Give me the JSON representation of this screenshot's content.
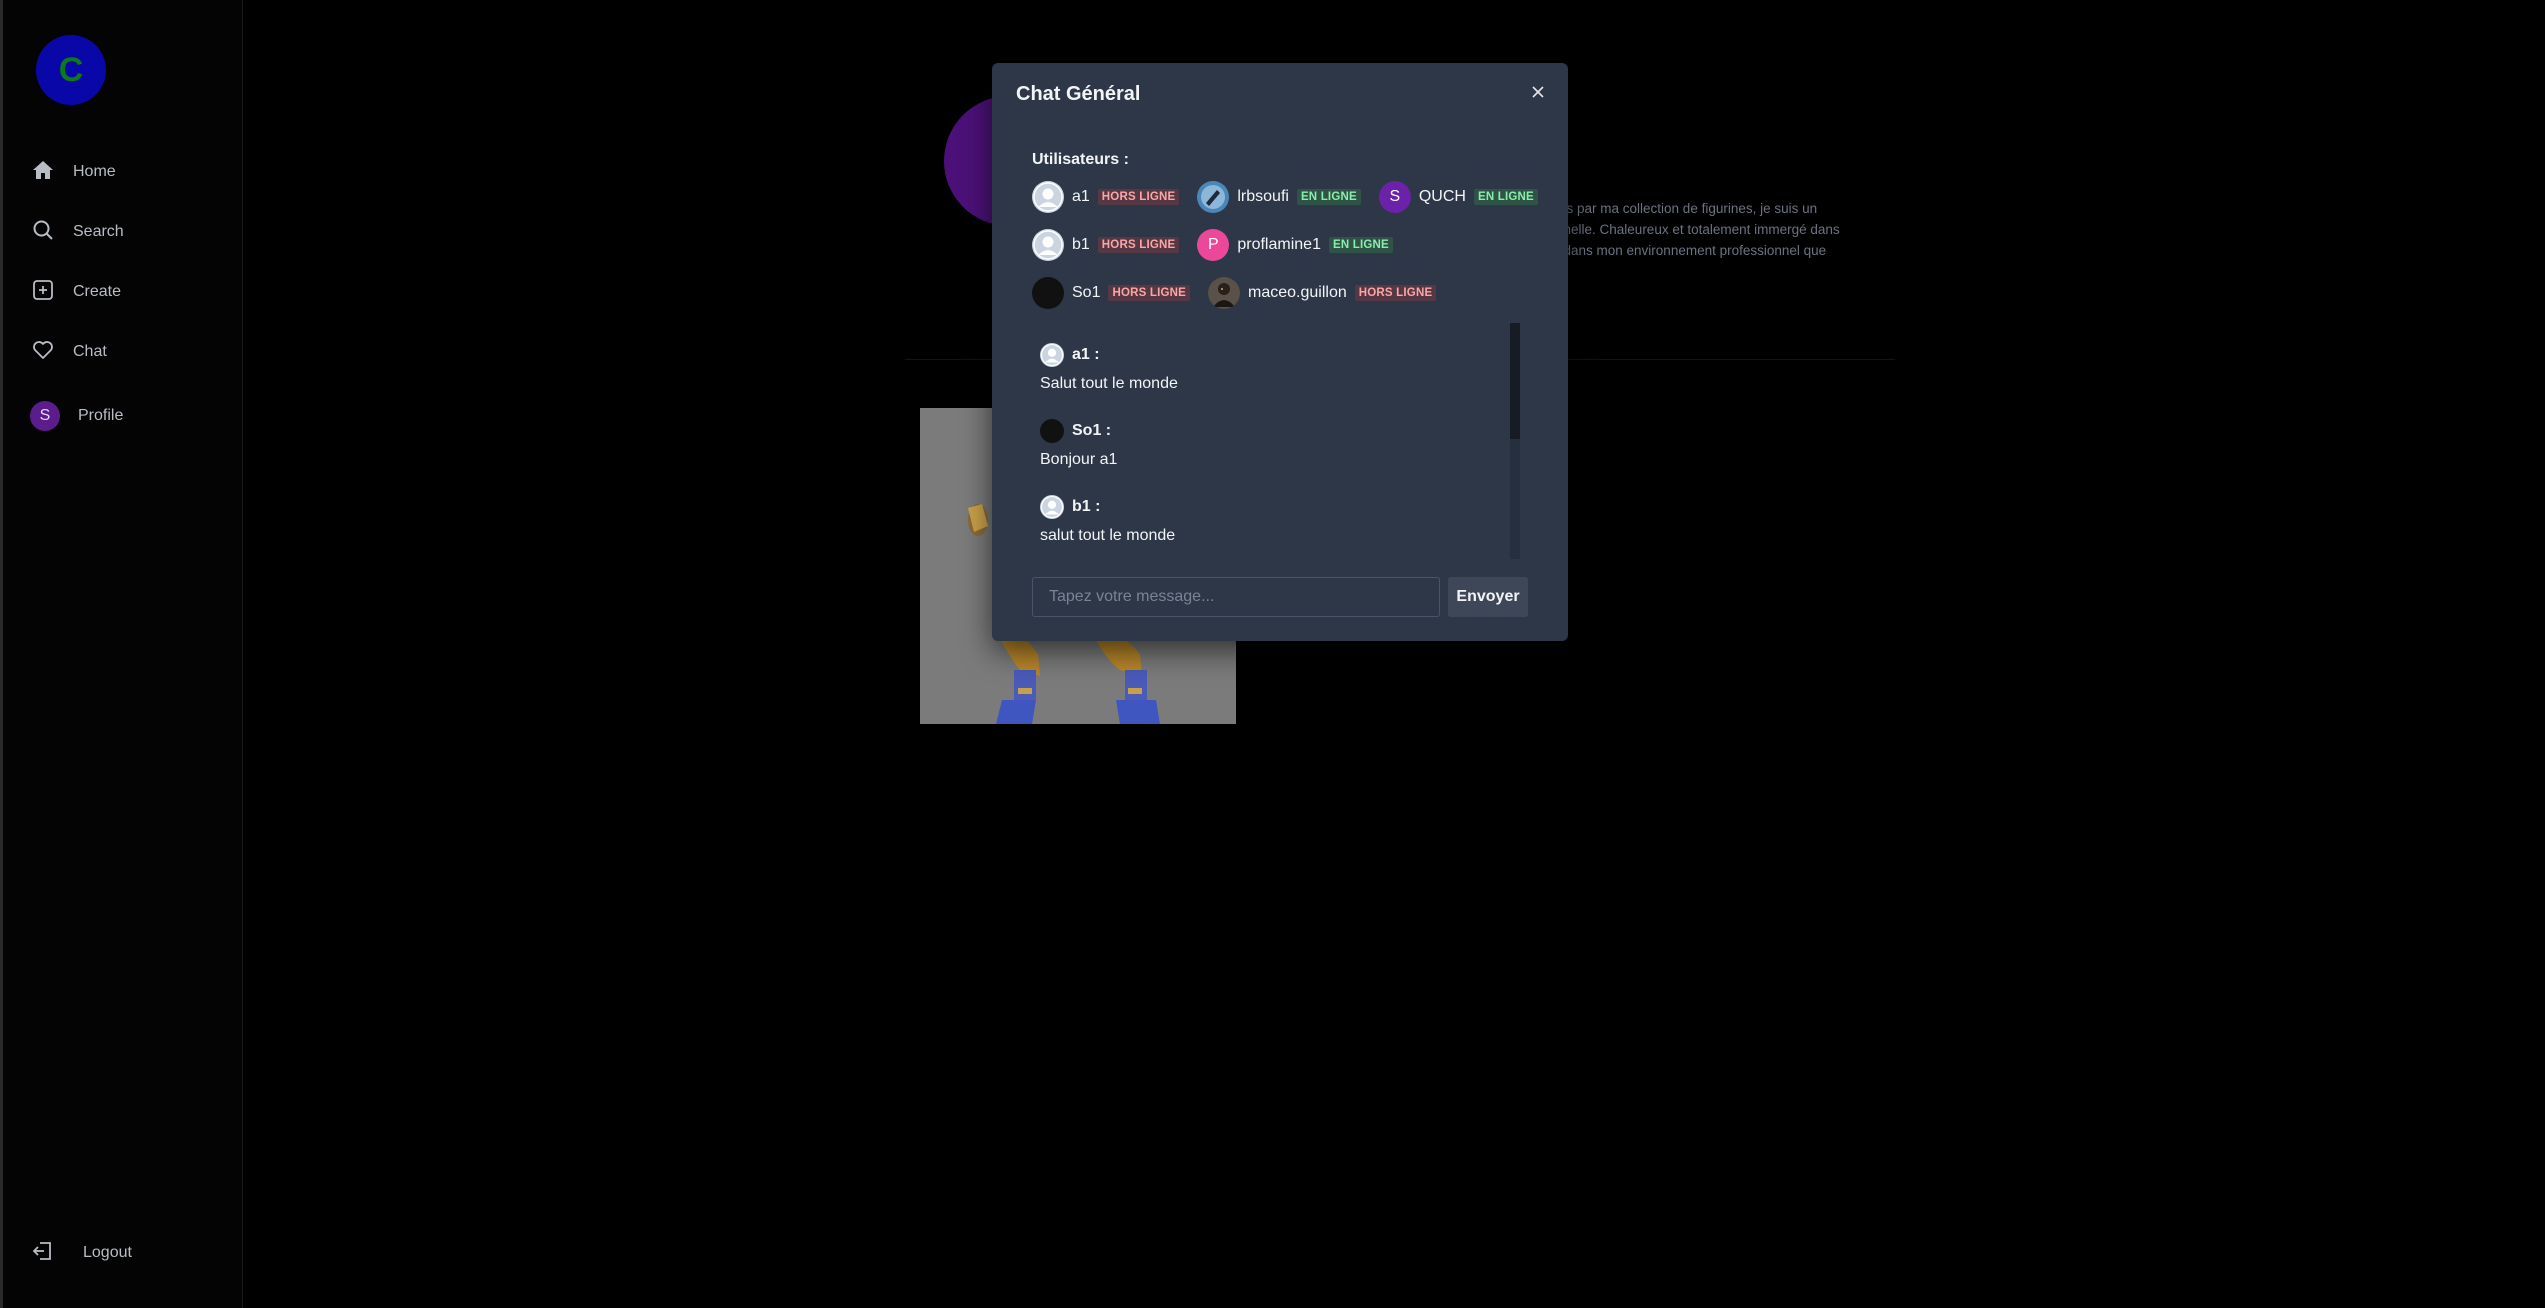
{
  "sidebar": {
    "logo_letter": "C",
    "items": [
      {
        "label": "Home",
        "icon": "home-icon"
      },
      {
        "label": "Search",
        "icon": "search-icon"
      },
      {
        "label": "Create",
        "icon": "plus-square-icon"
      },
      {
        "label": "Chat",
        "icon": "heart-icon"
      },
      {
        "label": "Profile",
        "avatar_letter": "S"
      }
    ],
    "logout_label": "Logout"
  },
  "background": {
    "bio_lines": [
      "les par ma collection de figurines, je suis un",
      "nnelle. Chaleureux et totalement immergé dans",
      "t dans mon environnement professionnel que"
    ]
  },
  "modal": {
    "title": "Chat Général",
    "users_label": "Utilisateurs :",
    "users": [
      {
        "name": "a1",
        "status": "HORS LIGNE",
        "online": false,
        "avatar": "default"
      },
      {
        "name": "lrbsoufi",
        "status": "EN LIGNE",
        "online": true,
        "avatar": "photo"
      },
      {
        "name": "QUCH",
        "status": "EN LIGNE",
        "online": true,
        "avatar": "letter",
        "letter": "S"
      },
      {
        "name": "b1",
        "status": "HORS LIGNE",
        "online": false,
        "avatar": "default"
      },
      {
        "name": "proflamine1",
        "status": "EN LIGNE",
        "online": true,
        "avatar": "letter",
        "letter": "P"
      },
      {
        "name": "So1",
        "status": "HORS LIGNE",
        "online": false,
        "avatar": "dark"
      },
      {
        "name": "maceo.guillon",
        "status": "HORS LIGNE",
        "online": false,
        "avatar": "photo2"
      }
    ],
    "messages": [
      {
        "author": "a1 :",
        "text": "Salut tout le monde",
        "avatar": "default"
      },
      {
        "author": "So1 :",
        "text": "Bonjour a1",
        "avatar": "dark"
      },
      {
        "author": "b1 :",
        "text": "salut tout le monde",
        "avatar": "default"
      }
    ],
    "input_placeholder": "Tapez votre message...",
    "send_label": "Envoyer"
  }
}
